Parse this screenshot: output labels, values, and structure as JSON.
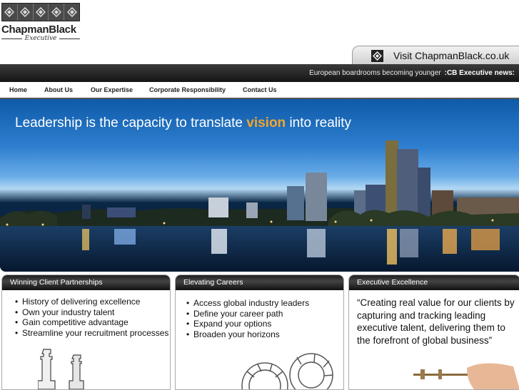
{
  "brand": {
    "name": "ChapmanBlack",
    "tagline": "Executive",
    "icon": "chess-diamond-icon"
  },
  "visit_link": {
    "label": "Visit ChapmanBlack.co.uk",
    "icon": "diamond-logo-icon"
  },
  "news": {
    "label": ":CB Executive news:",
    "headline": "European boardrooms becoming younger"
  },
  "nav": {
    "items": [
      {
        "label": "Home"
      },
      {
        "label": "About Us"
      },
      {
        "label": "Our Expertise"
      },
      {
        "label": "Corporate Responsibility"
      },
      {
        "label": "Contact Us"
      }
    ]
  },
  "hero": {
    "tagline_before": "Leadership is the capacity to translate",
    "tagline_highlight": "vision",
    "tagline_after": "into reality",
    "highlight_color": "#f4a52a"
  },
  "panels": [
    {
      "title": "Winning Client Partnerships",
      "items": [
        "History of delivering excellence",
        "Own your industry talent",
        "Gain competitive advantage",
        "Streamline your recruitment processes"
      ],
      "image": "chess-pieces"
    },
    {
      "title": "Elevating Careers",
      "items": [
        "Access global industry leaders",
        "Define your career path",
        "Expand your options",
        "Broaden your horizons"
      ],
      "image": "gears"
    },
    {
      "title": "Executive Excellence",
      "quote": "“Creating real value for our clients by capturing and tracking leading executive talent, delivering them to the forefront of global business”",
      "image": "hand-with-tool"
    }
  ]
}
